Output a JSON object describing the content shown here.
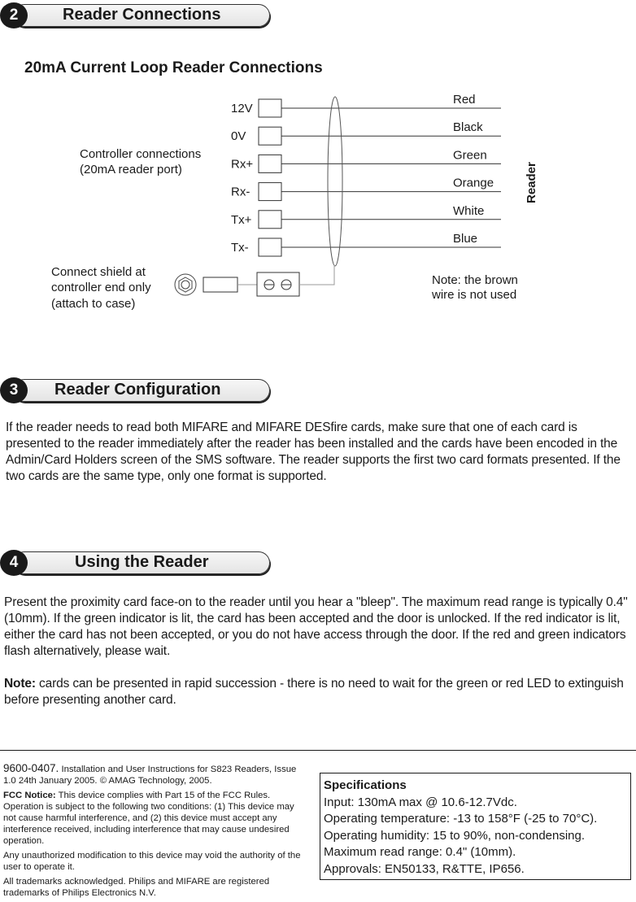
{
  "sections": [
    {
      "number": "2",
      "title": "Reader Connections"
    },
    {
      "number": "3",
      "title": "Reader Configuration"
    },
    {
      "number": "4",
      "title": "Using the Reader"
    }
  ],
  "diagram": {
    "title": "20mA Current Loop Reader Connections",
    "controller_label_line1": "Controller connections",
    "controller_label_line2": "(20mA reader port)",
    "terminals": [
      "12V",
      "0V",
      "Rx+",
      "Rx-",
      "Tx+",
      "Tx-"
    ],
    "wire_colors": [
      "Red",
      "Black",
      "Green",
      "Orange",
      "White",
      "Blue"
    ],
    "reader_label": "Reader",
    "shield_note_line1": "Connect shield at",
    "shield_note_line2": "controller end only",
    "shield_note_line3": "(attach to case)",
    "brown_note_line1": "Note: the brown",
    "brown_note_line2": "wire is not used"
  },
  "configuration": {
    "text": "If the reader needs to read both MIFARE and MIFARE DESfire cards, make sure that one of each card is presented to the reader immediately after the reader has been installed and the cards have been encoded in the Admin/Card Holders screen of the SMS software. The reader supports the first two card formats presented. If the two cards are the same type, only one format is supported."
  },
  "usage": {
    "text": "Present the proximity card face-on to the reader until you hear a \"bleep\". The maximum read range is typically 0.4\" (10mm). If the green indicator is lit, the card has been accepted and the door is unlocked. If the red indicator is lit, either the card has not been accepted, or you do not have access through the door. If the red and green indicators flash alternatively, please wait.",
    "note_label": "Note:",
    "note_text": " cards can be presented in rapid succession - there is no need to wait for the green or red LED to extinguish before presenting another card."
  },
  "footer": {
    "doc_number": "9600-0407.",
    "doc_info": " Installation and User Instructions for S823 Readers, Issue 1.0 24th January 2005. © AMAG Technology, 2005.",
    "fcc_label": "FCC Notice:",
    "fcc_text": " This device complies with Part 15 of the FCC Rules. Operation is subject to the following two conditions: (1) This device may not cause harmful interference, and (2) this device must accept any interference received, including interference that may cause undesired operation.",
    "modification": "Any unauthorized modification to this device may void the authority of the user to operate it.",
    "trademarks": "All trademarks acknowledged. Philips and MIFARE are registered trademarks of Philips Electronics N.V."
  },
  "specifications": {
    "title": "Specifications",
    "items": [
      "Input: 130mA max @ 10.6-12.7Vdc.",
      "Operating temperature: -13 to 158°F (-25 to 70°C).",
      "Operating humidity: 15 to 90%, non-condensing.",
      "Maximum read range: 0.4\" (10mm).",
      "Approvals: EN50133, R&TTE, IP656."
    ]
  }
}
